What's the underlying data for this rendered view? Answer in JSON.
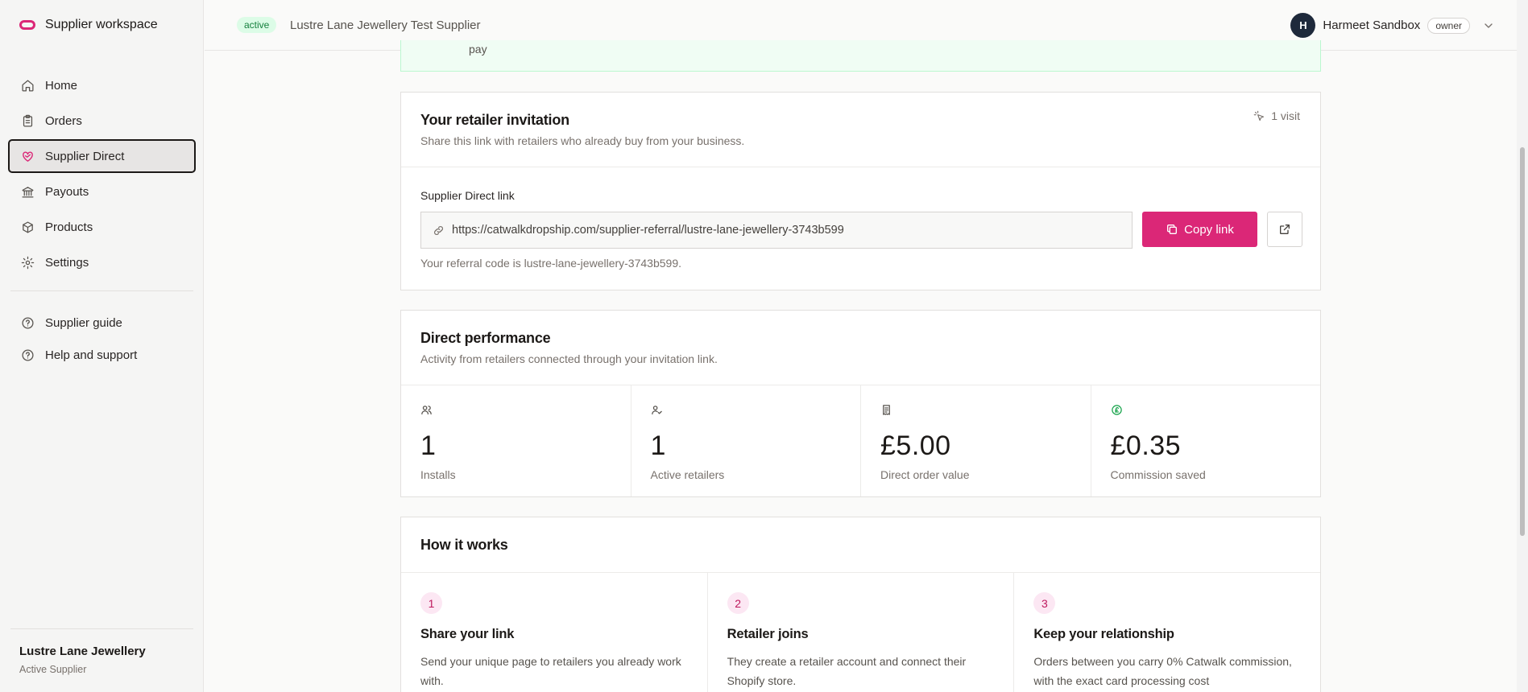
{
  "sidebar": {
    "brand": "Supplier workspace",
    "items": [
      {
        "label": "Home"
      },
      {
        "label": "Orders"
      },
      {
        "label": "Supplier Direct"
      },
      {
        "label": "Payouts"
      },
      {
        "label": "Products"
      },
      {
        "label": "Settings"
      }
    ],
    "secondary": [
      {
        "label": "Supplier guide"
      },
      {
        "label": "Help and support"
      }
    ],
    "org_name": "Lustre Lane Jewellery",
    "org_status": "Active Supplier"
  },
  "topbar": {
    "status_badge": "active",
    "supplier_name": "Lustre Lane Jewellery Test Supplier",
    "user_initial": "H",
    "user_name": "Harmeet Sandbox",
    "user_role": "owner"
  },
  "banner": {
    "text": "pay"
  },
  "invitation": {
    "title": "Your retailer invitation",
    "subtitle": "Share this link with retailers who already buy from your business.",
    "visits": "1 visit",
    "link_label": "Supplier Direct link",
    "link_url": "https://catwalkdropship.com/supplier-referral/lustre-lane-jewellery-3743b599",
    "copy_label": "Copy link",
    "referral_text": "Your referral code is lustre-lane-jewellery-3743b599."
  },
  "performance": {
    "title": "Direct performance",
    "subtitle": "Activity from retailers connected through your invitation link.",
    "stats": [
      {
        "icon": "users-icon",
        "value": "1",
        "label": "Installs"
      },
      {
        "icon": "user-check-icon",
        "value": "1",
        "label": "Active retailers"
      },
      {
        "icon": "receipt-icon",
        "value": "£5.00",
        "label": "Direct order value"
      },
      {
        "icon": "pound-coin-icon",
        "value": "£0.35",
        "label": "Commission saved",
        "icon_color": "#16a34a"
      }
    ]
  },
  "how": {
    "title": "How it works",
    "steps": [
      {
        "num": "1",
        "title": "Share your link",
        "desc": "Send your unique page to retailers you already work with."
      },
      {
        "num": "2",
        "title": "Retailer joins",
        "desc": "They create a retailer account and connect their Shopify store."
      },
      {
        "num": "3",
        "title": "Keep your relationship",
        "desc": "Orders between you carry 0% Catwalk commission, with the exact card processing cost"
      }
    ]
  },
  "colors": {
    "accent": "#db2777",
    "active_badge_bg": "#dcfce7",
    "active_badge_text": "#15803d"
  }
}
